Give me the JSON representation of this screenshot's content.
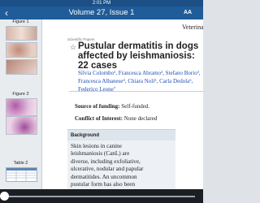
{
  "status_bar": {
    "time": "2:01 PM"
  },
  "nav": {
    "title": "Volume 27, Issue 1",
    "font_button": "AA",
    "back_icon": "back-arrow-icon"
  },
  "sidebar": {
    "items": [
      {
        "label": "Figure 1"
      },
      {
        "label": "Figure 2"
      },
      {
        "label": "Table 2"
      }
    ]
  },
  "article": {
    "journal_name": "Veterinary Dermatology",
    "section": "Scientific Papers",
    "title": "Pustular dermatitis in dogs affected by leishmaniosis: 22 cases",
    "authors": "Silvia Colombo¹, Francesca Abramo², Stefano Borio³, Francesca Albanese⁴, Chiara Noli⁵, Carla Dedola⁶, Federico Leone⁷",
    "funding_label": "Source of funding:",
    "funding_value": "Self-funded.",
    "conflict_label": "Conflict of Interest:",
    "conflict_value": "None declared",
    "background_heading": "Background",
    "background_text": "Skin lesions in canine leishmaniosis (CanL) are diverse, including exfoliative, ulcerative, nodular and papular dermatitides. An uncommon pustular form has also been reported"
  }
}
